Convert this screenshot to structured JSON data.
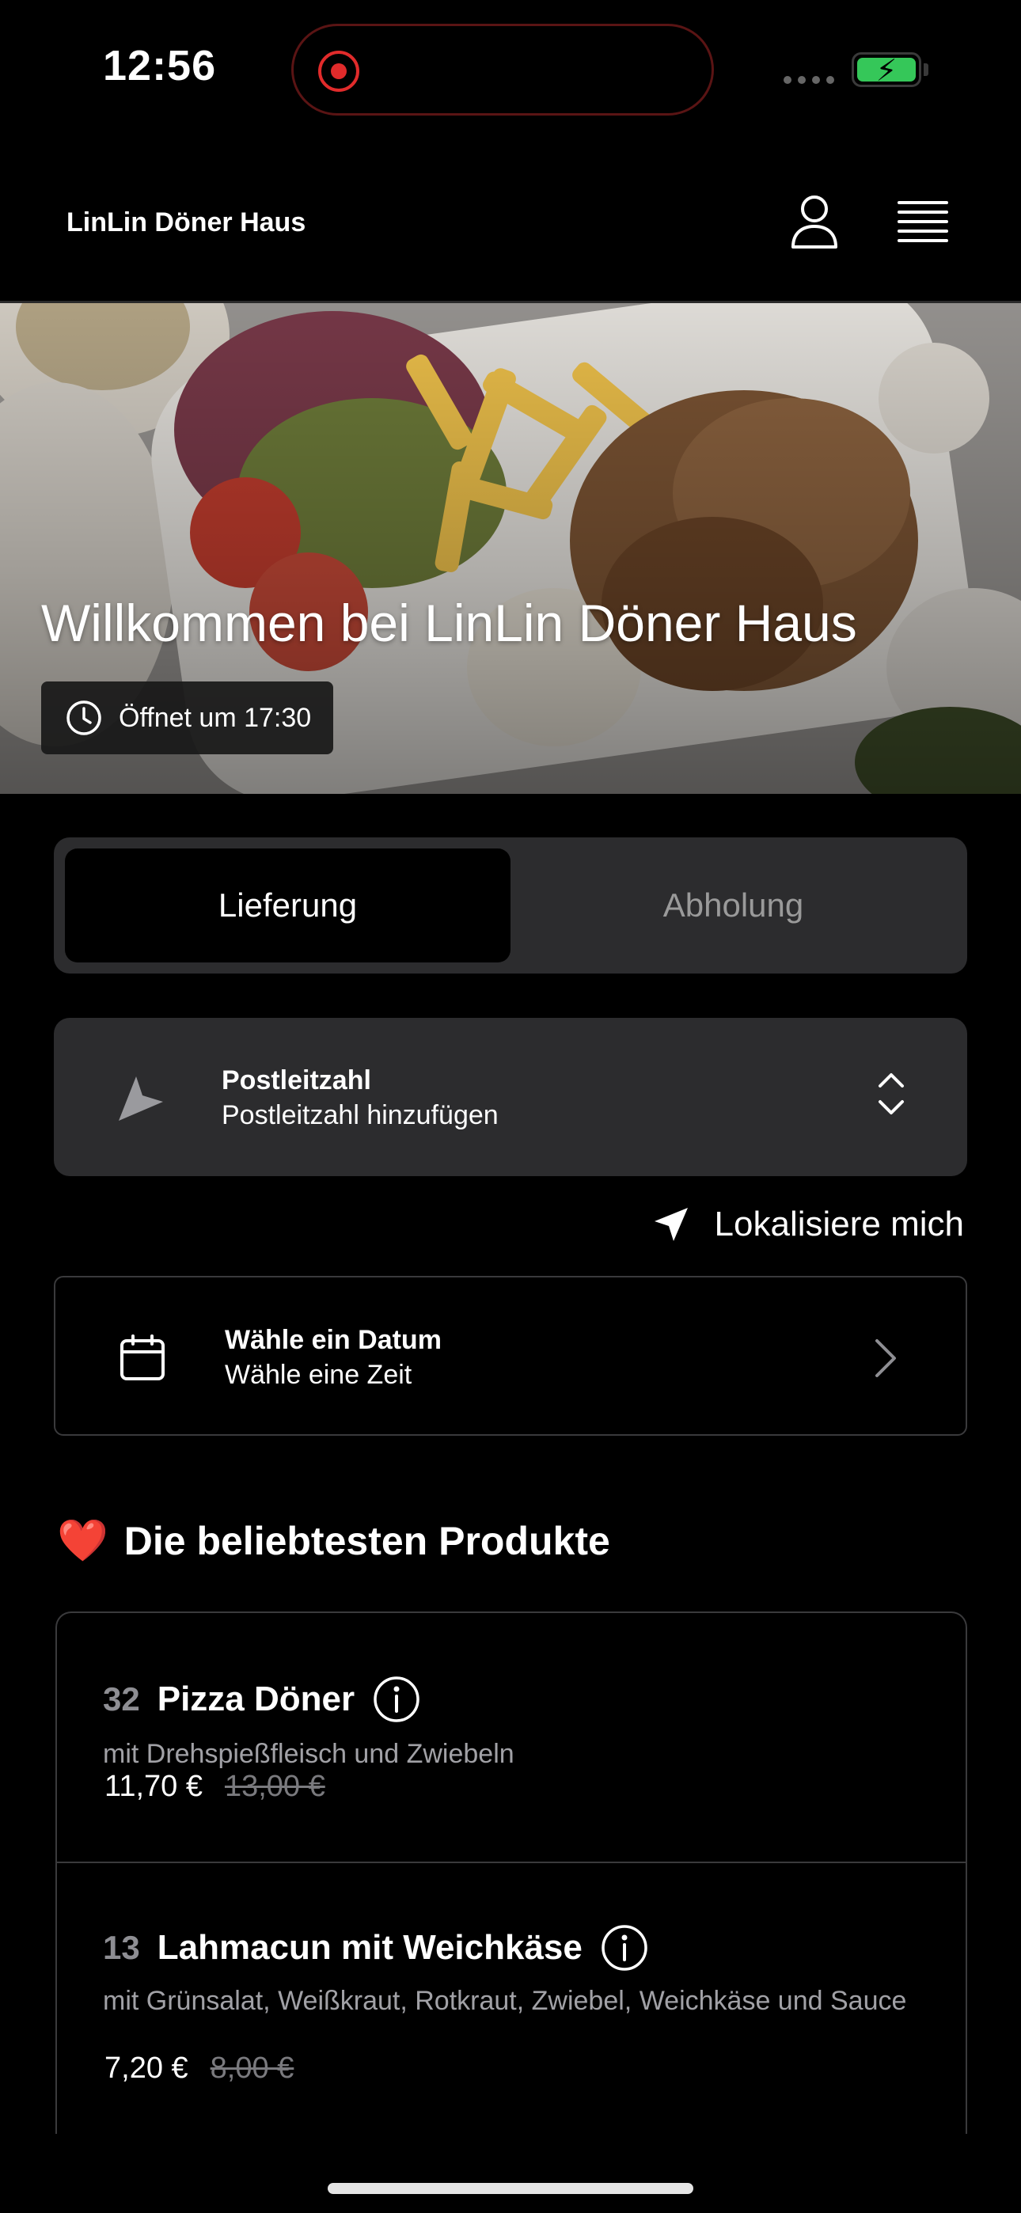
{
  "status_bar": {
    "time": "12:56",
    "recording_color": "#e12b2b",
    "battery_color": "#35c759",
    "battery_bolt": "⚡"
  },
  "header": {
    "brand": "LinLin Döner Haus",
    "account_icon": "user-icon",
    "menu_icon": "hamburger-icon"
  },
  "hero": {
    "title": "Willkommen bei LinLin Döner Haus",
    "opening_label": "Öffnet um 17:30",
    "clock_icon": "clock-icon"
  },
  "order_mode": {
    "options": [
      "Lieferung",
      "Abholung"
    ],
    "selected": "Lieferung"
  },
  "postcode": {
    "title": "Postleitzahl",
    "placeholder": "Postleitzahl hinzufügen",
    "icon": "navigation-arrow-icon"
  },
  "locate": {
    "label": "Lokalisiere mich",
    "icon": "location-arrow-icon"
  },
  "schedule": {
    "title": "Wähle ein Datum",
    "subtitle": "Wähle eine Zeit",
    "icon": "calendar-icon"
  },
  "popular": {
    "emoji": "❤️",
    "heading": "Die beliebtesten Produkte",
    "products": [
      {
        "number": "32",
        "name": "Pizza Döner",
        "description": "mit Drehspießfleisch und Zwiebeln",
        "price": "11,70 €",
        "old_price": "13,00 €"
      },
      {
        "number": "13",
        "name": "Lahmacun mit Weichkäse",
        "description": "mit Grünsalat, Weißkraut, Rotkraut, Zwiebel, Weichkäse und Sauce",
        "price": "7,20 €",
        "old_price": "8,00 €"
      }
    ]
  }
}
